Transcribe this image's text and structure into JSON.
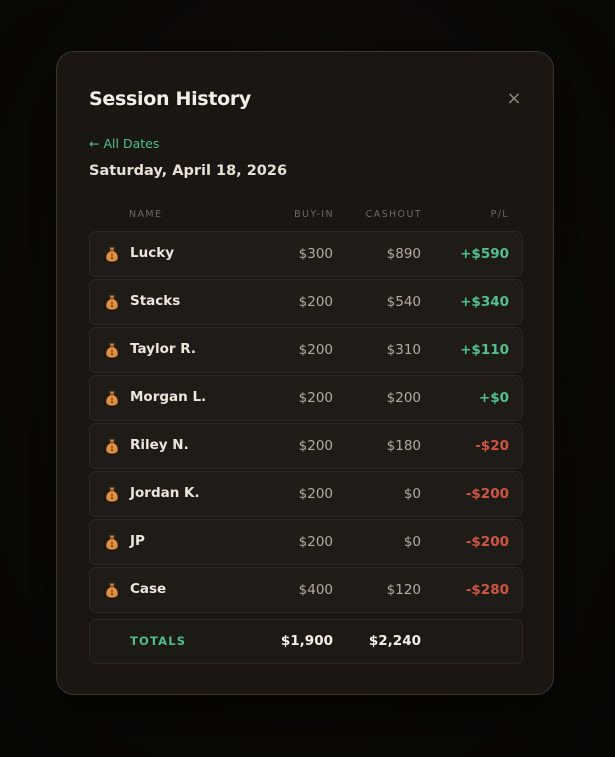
{
  "modal": {
    "title": "Session History",
    "close_label": "×",
    "back_link": "All Dates",
    "back_arrow": "←",
    "date": "Saturday, April 18, 2026"
  },
  "table": {
    "headers": {
      "name": "NAME",
      "buyin": "BUY-IN",
      "cashout": "CASHOUT",
      "pl": "P/L"
    },
    "rows": [
      {
        "name": "Lucky",
        "buyin": "$300",
        "cashout": "$890",
        "pl": "+$590",
        "sign": "pos"
      },
      {
        "name": "Stacks",
        "buyin": "$200",
        "cashout": "$540",
        "pl": "+$340",
        "sign": "pos"
      },
      {
        "name": "Taylor R.",
        "buyin": "$200",
        "cashout": "$310",
        "pl": "+$110",
        "sign": "pos"
      },
      {
        "name": "Morgan L.",
        "buyin": "$200",
        "cashout": "$200",
        "pl": "+$0",
        "sign": "pos"
      },
      {
        "name": "Riley N.",
        "buyin": "$200",
        "cashout": "$180",
        "pl": "-$20",
        "sign": "neg"
      },
      {
        "name": "Jordan K.",
        "buyin": "$200",
        "cashout": "$0",
        "pl": "-$200",
        "sign": "neg"
      },
      {
        "name": "JP",
        "buyin": "$200",
        "cashout": "$0",
        "pl": "-$200",
        "sign": "neg"
      },
      {
        "name": "Case",
        "buyin": "$400",
        "cashout": "$120",
        "pl": "-$280",
        "sign": "neg"
      }
    ],
    "row_icon": "money-bag-icon",
    "totals": {
      "label": "TOTALS",
      "buyin": "$1,900",
      "cashout": "$2,240"
    }
  },
  "colors": {
    "accent": "#4fbf8a",
    "positive": "#53c08d",
    "negative": "#d0553f",
    "modal_bg": "#191613",
    "row_bg": "#1e1b18"
  }
}
